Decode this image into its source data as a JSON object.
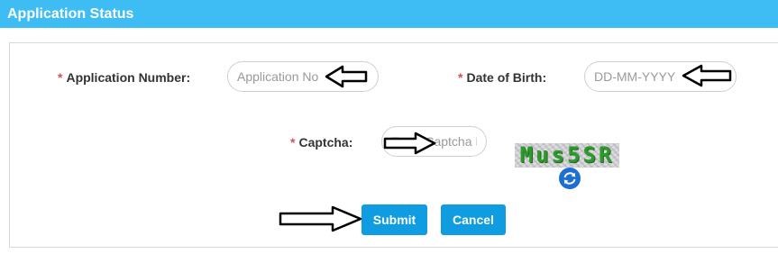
{
  "header": {
    "title": "Application Status"
  },
  "form": {
    "required_marker": "*",
    "application_number": {
      "label": "Application Number:",
      "placeholder": "Application No"
    },
    "date_of_birth": {
      "label": "Date of Birth:",
      "placeholder": "DD-MM-YYYY"
    },
    "captcha": {
      "label": "Captcha:",
      "placeholder": "Enter Captcha I",
      "image_text": "Mus5SR"
    }
  },
  "buttons": {
    "submit": "Submit",
    "cancel": "Cancel"
  },
  "colors": {
    "header_bg": "#3ebdf5",
    "button_bg": "#0f9ce0",
    "required": "#d9534f",
    "captcha_text": "#2e9a2e",
    "refresh_bg": "#1d6fd1"
  },
  "icons": {
    "refresh": "refresh-icon",
    "annotation_arrow": "arrow-right-icon"
  }
}
